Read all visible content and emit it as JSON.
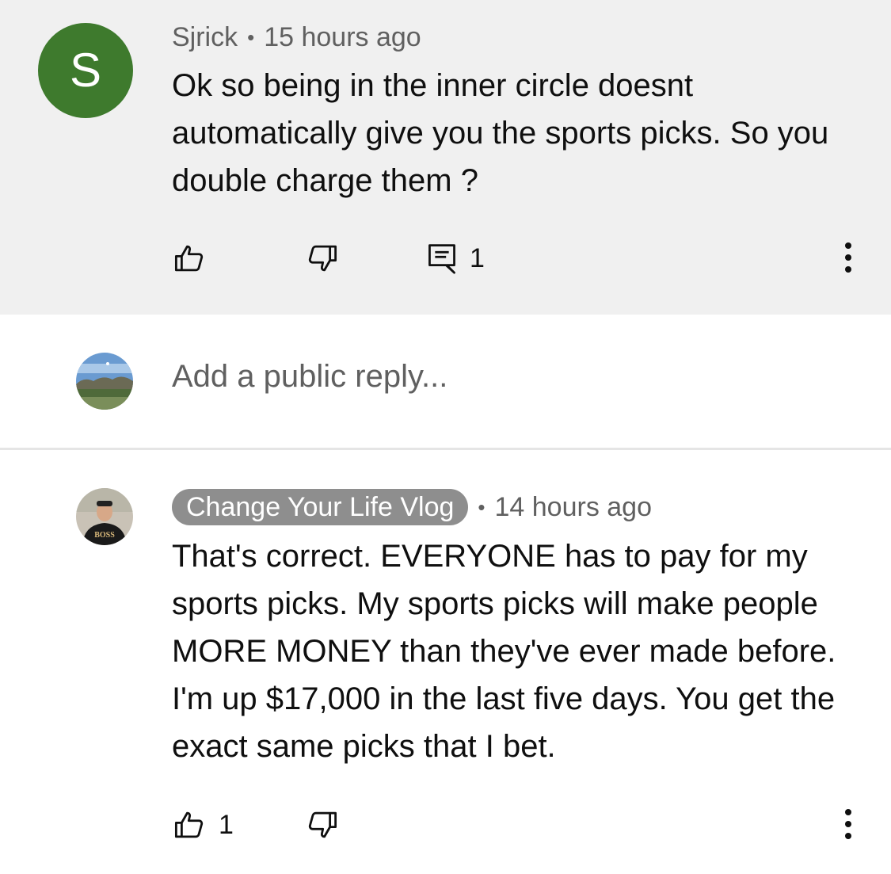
{
  "comment": {
    "avatar_letter": "S",
    "author": "Sjrick",
    "separator": "•",
    "time": "15 hours ago",
    "text": "Ok so being in the inner circle doesnt automatically give you the sports picks. So you double charge them ?",
    "reply_count": "1",
    "avatar_color": "#3e7a2d"
  },
  "reply_box": {
    "placeholder": "Add a public reply..."
  },
  "reply": {
    "author": "Change Your Life Vlog",
    "separator": "•",
    "time": "14 hours ago",
    "text": "That's correct. EVERYONE has to pay for my sports picks. My sports picks will make people MORE MONEY than they've ever made before. I'm up $17,000 in the last five days. You get the exact same picks that I bet.",
    "like_count": "1",
    "avatar_shirt_text": "BOSS"
  },
  "icons": {
    "like": "thumbs-up-icon",
    "dislike": "thumbs-down-icon",
    "reply": "comment-reply-icon",
    "more": "more-vert-icon"
  }
}
